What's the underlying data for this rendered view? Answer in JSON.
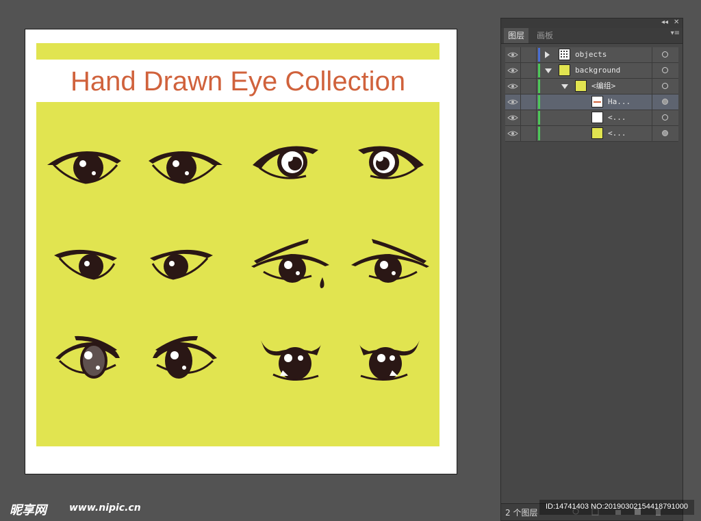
{
  "colors": {
    "workspace": "#535353",
    "accent_yellow": "#e1e450",
    "title_orange": "#d0623c",
    "eye_ink": "#2a1715",
    "layer_blue": "#4a6fd4",
    "layer_green": "#4ec95a"
  },
  "artboard": {
    "title": "Hand Drawn Eye Collection",
    "eye_count": 12
  },
  "layers_panel": {
    "tabs": [
      {
        "label": "图层",
        "active": true
      },
      {
        "label": "画板",
        "active": false
      }
    ],
    "rows": [
      {
        "name": "objects",
        "indent": 0,
        "expanded": false,
        "toggle": "right",
        "thumb": "grid-thumb",
        "bar": "#4a6fd4",
        "target": "hollow",
        "selected": false
      },
      {
        "name": "background",
        "indent": 0,
        "expanded": true,
        "toggle": "down",
        "thumb": "yellow-thumb",
        "bar": "#4ec95a",
        "target": "hollow",
        "selected": false
      },
      {
        "name": "<编组>",
        "indent": 1,
        "expanded": true,
        "toggle": "down",
        "thumb": "yellow-thumb",
        "bar": "#4ec95a",
        "target": "hollow",
        "selected": false
      },
      {
        "name": "Ha...",
        "indent": 2,
        "toggle": "none",
        "thumb": "text-thumb",
        "bar": "#4ec95a",
        "target": "filled",
        "selected": true
      },
      {
        "name": "<...",
        "indent": 2,
        "toggle": "none",
        "thumb": "white-thumb",
        "bar": "#4ec95a",
        "target": "hollow",
        "selected": false
      },
      {
        "name": "<...",
        "indent": 2,
        "toggle": "none",
        "thumb": "yellow-thumb",
        "bar": "#4ec95a",
        "target": "filled",
        "selected": false
      }
    ],
    "layer_count": "2 个图层"
  },
  "watermark": {
    "logo": "昵享网",
    "url": "www.nipic.cn",
    "id_text": "ID:14741403 NO:20190302154418791000"
  }
}
